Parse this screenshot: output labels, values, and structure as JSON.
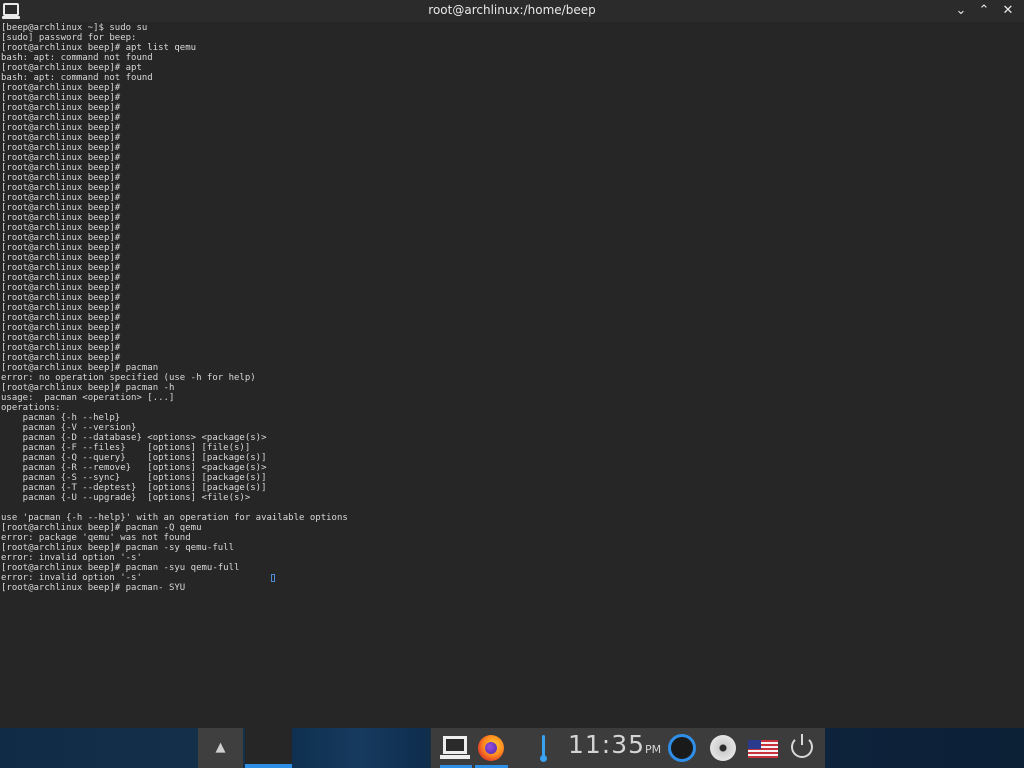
{
  "window": {
    "title": "root@archlinux:/home/beep",
    "controls": {
      "minimize": "⌄",
      "maximize": "⌃",
      "close": "✕"
    },
    "icon": "terminal-icon"
  },
  "terminal": {
    "lines": [
      "[beep@archlinux ~]$ sudo su",
      "[sudo] password for beep:",
      "[root@archlinux beep]# apt list qemu",
      "bash: apt: command not found",
      "[root@archlinux beep]# apt",
      "bash: apt: command not found",
      "[root@archlinux beep]#",
      "[root@archlinux beep]#",
      "[root@archlinux beep]#",
      "[root@archlinux beep]#",
      "[root@archlinux beep]#",
      "[root@archlinux beep]#",
      "[root@archlinux beep]#",
      "[root@archlinux beep]#",
      "[root@archlinux beep]#",
      "[root@archlinux beep]#",
      "[root@archlinux beep]#",
      "[root@archlinux beep]#",
      "[root@archlinux beep]#",
      "[root@archlinux beep]#",
      "[root@archlinux beep]#",
      "[root@archlinux beep]#",
      "[root@archlinux beep]#",
      "[root@archlinux beep]#",
      "[root@archlinux beep]#",
      "[root@archlinux beep]#",
      "[root@archlinux beep]#",
      "[root@archlinux beep]#",
      "[root@archlinux beep]#",
      "[root@archlinux beep]#",
      "[root@archlinux beep]#",
      "[root@archlinux beep]#",
      "[root@archlinux beep]#",
      "[root@archlinux beep]#",
      "[root@archlinux beep]# pacman",
      "error: no operation specified (use -h for help)",
      "[root@archlinux beep]# pacman -h",
      "usage:  pacman <operation> [...]",
      "operations:",
      "    pacman {-h --help}",
      "    pacman {-V --version}",
      "    pacman {-D --database} <options> <package(s)>",
      "    pacman {-F --files}    [options] [file(s)]",
      "    pacman {-Q --query}    [options] [package(s)]",
      "    pacman {-R --remove}   [options] <package(s)>",
      "    pacman {-S --sync}     [options] [package(s)]",
      "    pacman {-T --deptest}  [options] [package(s)]",
      "    pacman {-U --upgrade}  [options] <file(s)>",
      "",
      "use 'pacman {-h --help}' with an operation for available options",
      "[root@archlinux beep]# pacman -Q qemu",
      "error: package 'qemu' was not found",
      "[root@archlinux beep]# pacman -sy qemu-full",
      "error: invalid option '-s'",
      "[root@archlinux beep]# pacman -syu qemu-full",
      "error: invalid option '-s'",
      "[root@archlinux beep]# pacman- SYU"
    ]
  },
  "taskbar": {
    "show_desktop": "▲",
    "clock": {
      "time": "11:35",
      "ampm": "PM"
    },
    "tray_icons": [
      "terminal-icon",
      "firefox-icon",
      "thermometer-icon",
      "ring-icon",
      "disc-icon",
      "us-flag-icon",
      "power-icon"
    ],
    "accent": "#2e8fe6"
  }
}
